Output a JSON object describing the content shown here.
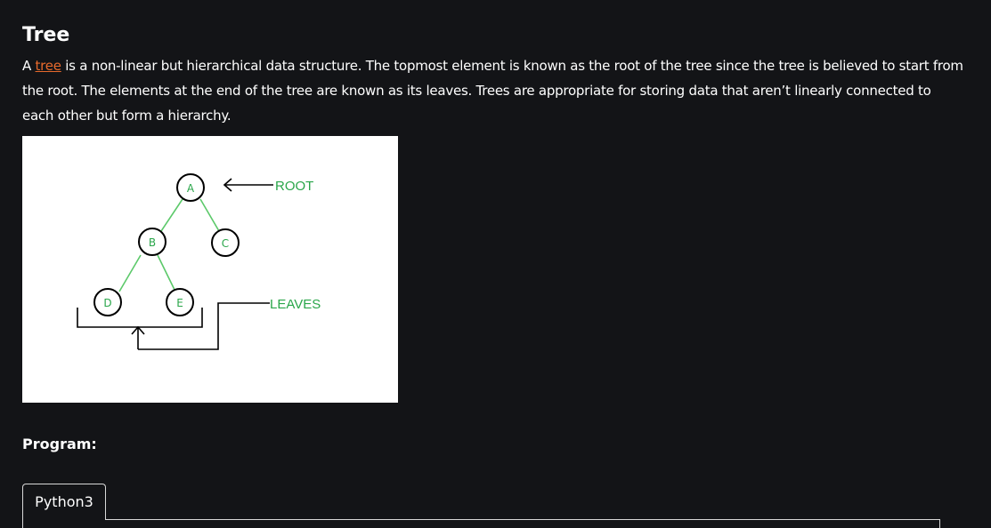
{
  "heading": "Tree",
  "intro": {
    "prefix": "A ",
    "link_text": "tree",
    "rest": " is a non-linear but hierarchical data structure. The topmost element is known as the root of the tree since the tree is believed to start from the root. The elements at the end of the tree are known as its leaves. Trees are appropriate for storing data that aren’t linearly connected to each other but form a hierarchy."
  },
  "figure": {
    "nodes": [
      "A",
      "B",
      "C",
      "D",
      "E"
    ],
    "root_label": "ROOT",
    "leaves_label": "LEAVES",
    "colors": {
      "edge": "#5cc96a",
      "node_border": "#000000",
      "label": "#2aa64a",
      "bracket": "#000000"
    }
  },
  "program_label": "Program:",
  "code_tabs": {
    "active": "Python3"
  },
  "colors": {
    "page_background": "#131417",
    "link": "#e86a2c",
    "text": "#ffffff"
  }
}
